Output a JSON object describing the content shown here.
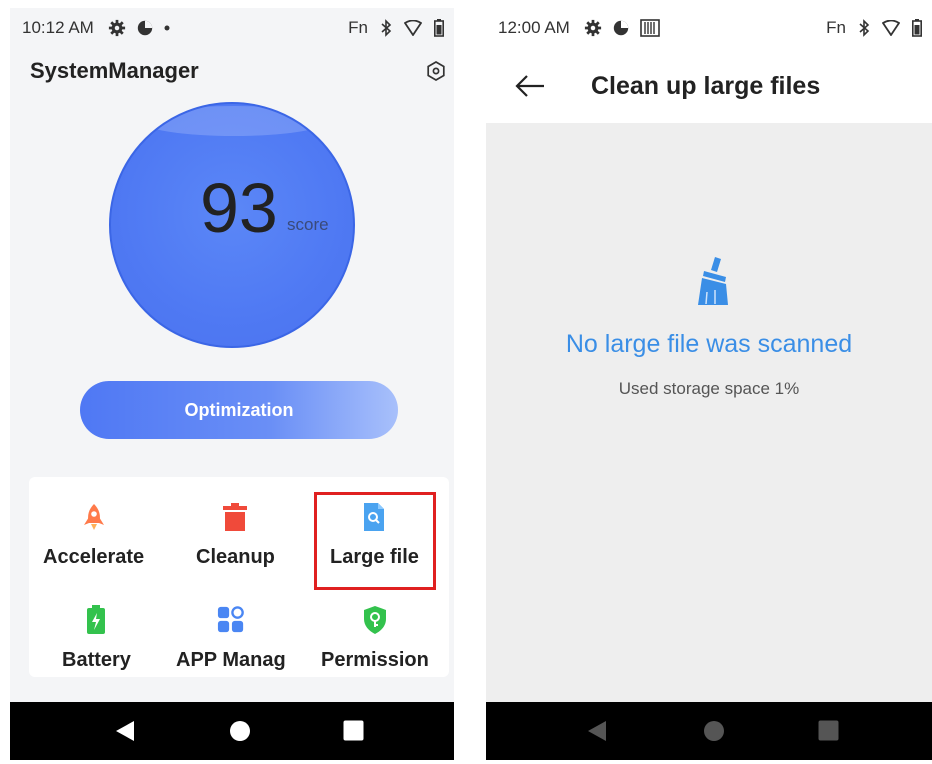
{
  "left": {
    "status": {
      "time": "10:12 AM",
      "fn": "Fn"
    },
    "app_title": "SystemManager",
    "score": {
      "value": "93",
      "unit": "score"
    },
    "optimize_label": "Optimization",
    "tiles": [
      {
        "label": "Accelerate",
        "icon": "rocket-icon"
      },
      {
        "label": "Cleanup",
        "icon": "trash-icon"
      },
      {
        "label": "Large file",
        "icon": "file-search-icon"
      },
      {
        "label": "Battery",
        "icon": "battery-icon"
      },
      {
        "label": "APP Manag",
        "icon": "apps-icon"
      },
      {
        "label": "Permission",
        "icon": "shield-key-icon"
      }
    ],
    "colors": {
      "accent": "#4f79f3",
      "highlight": "#e02020"
    }
  },
  "right": {
    "status": {
      "time": "12:00 AM",
      "fn": "Fn"
    },
    "title": "Clean up large files",
    "empty_message": "No large file was scanned",
    "storage_text": "Used storage space 1%",
    "colors": {
      "message": "#3a8ee6"
    }
  }
}
